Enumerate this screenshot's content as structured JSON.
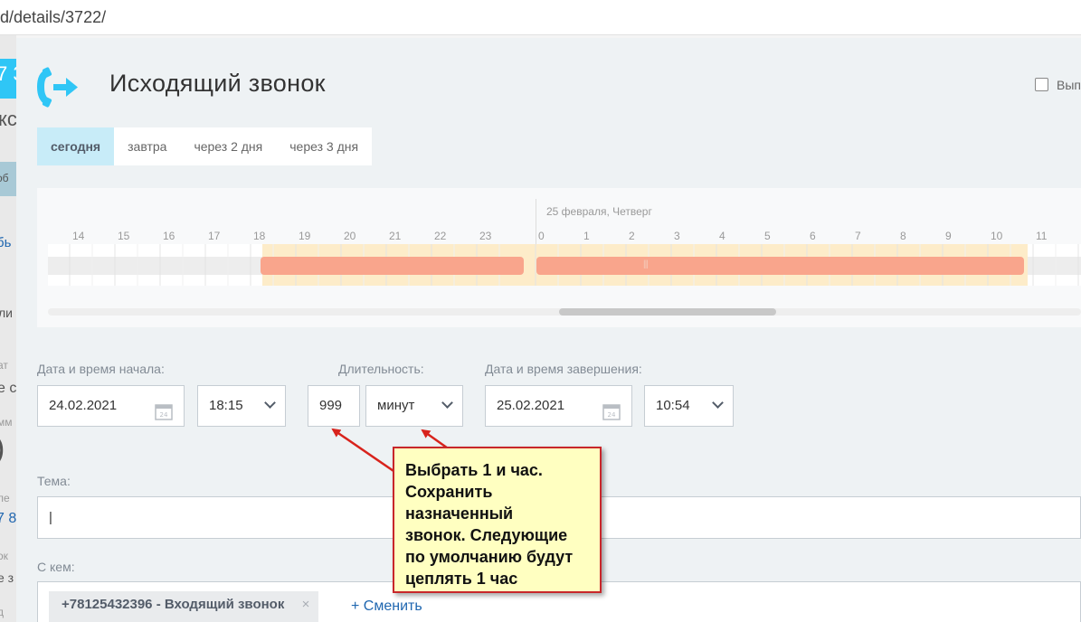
{
  "browser": {
    "url_fragment": "d/details/3722/"
  },
  "left_strip": [
    "7 3",
    "кс",
    "об",
    "бь",
    "ли",
    "ат",
    "е с",
    "мм",
    ")",
    "ле",
    "7 8",
    "ок",
    "е з",
    "д"
  ],
  "activity": {
    "title": "Исходящий звонок",
    "top_checkbox_label": "Вып"
  },
  "day_tabs": [
    "сегодня",
    "завтра",
    "через 2 дня",
    "через 3 дня"
  ],
  "timeline": {
    "date_label": "25 февраля, Четверг",
    "hours": [
      "14",
      "15",
      "16",
      "17",
      "18",
      "19",
      "20",
      "21",
      "22",
      "23",
      "0",
      "1",
      "2",
      "3",
      "4",
      "5",
      "6",
      "7",
      "8",
      "9",
      "10",
      "11",
      "1"
    ]
  },
  "form": {
    "start_label": "Дата и время начала:",
    "start_date": "24.02.2021",
    "start_time": "18:15",
    "duration_label": "Длительность:",
    "duration_value": "999",
    "duration_unit": "минут",
    "end_label": "Дата и время завершения:",
    "end_date": "25.02.2021",
    "end_time": "10:54",
    "subject_label": "Тема:",
    "subject_value": "|",
    "with_label": "С кем:",
    "contact": "+78125432396 - Входящий звонок",
    "contact_remove": "×",
    "change_link": "+ Сменить"
  },
  "annotation": {
    "lines": [
      "Выбрать 1 и час.",
      "Сохранить",
      "назначенный",
      "звонок.  Следующие",
      "по умолчанию будут",
      "цеплять 1 час"
    ]
  },
  "colors": {
    "accent": "#2fc6f6",
    "active_tab": "#c8ecf8",
    "bar": "#f9a58c",
    "busy": "#fdecc9",
    "callout_border": "#c8262a",
    "callout_bg": "#ffffc1"
  }
}
